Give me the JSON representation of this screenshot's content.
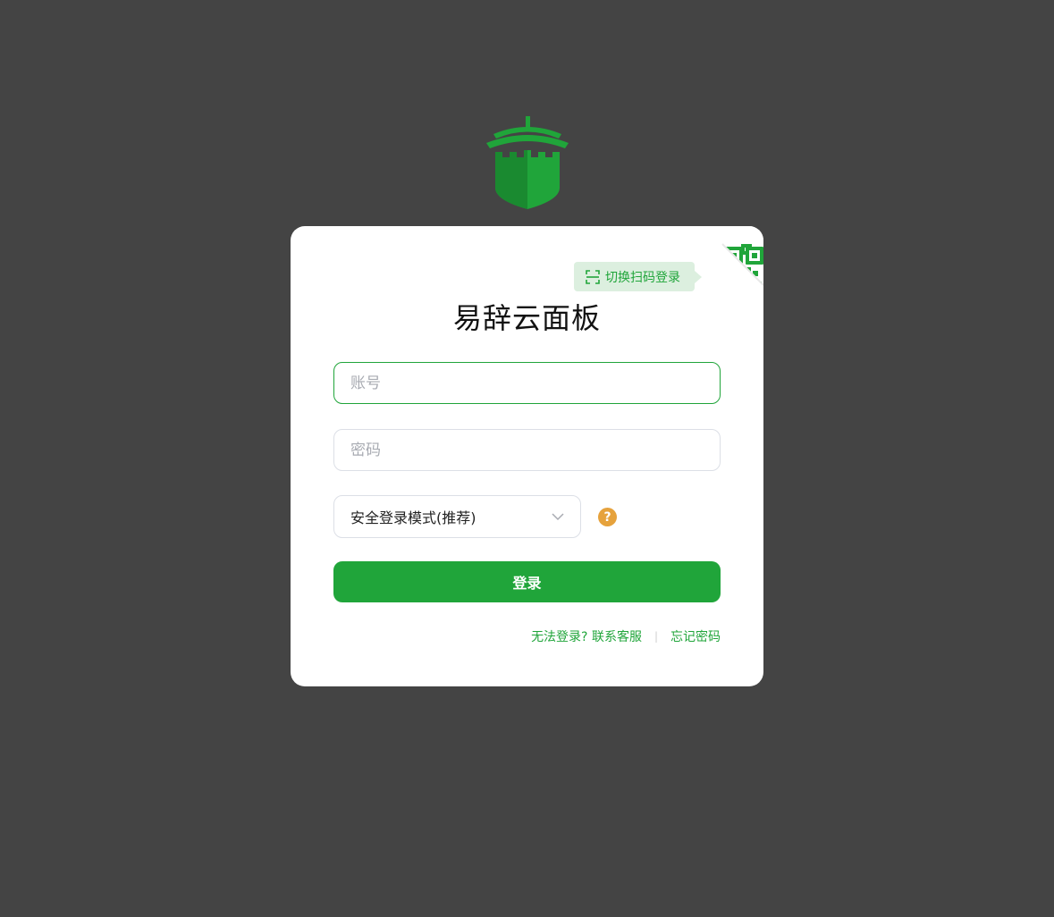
{
  "app": {
    "title": "易辞云面板",
    "logo": "castle-shield-logo",
    "brand_color": "#20a53a",
    "background_color": "#444444"
  },
  "qr_login": {
    "tip_label": "切换扫码登录",
    "icon": "qr-code-icon"
  },
  "form": {
    "account_placeholder": "账号",
    "password_placeholder": "密码",
    "login_mode_selected": "安全登录模式(推荐)",
    "help_symbol": "?",
    "submit_label": "登录"
  },
  "links": {
    "contact_support": "无法登录? 联系客服",
    "separator": "|",
    "forgot_password": "忘记密码"
  }
}
